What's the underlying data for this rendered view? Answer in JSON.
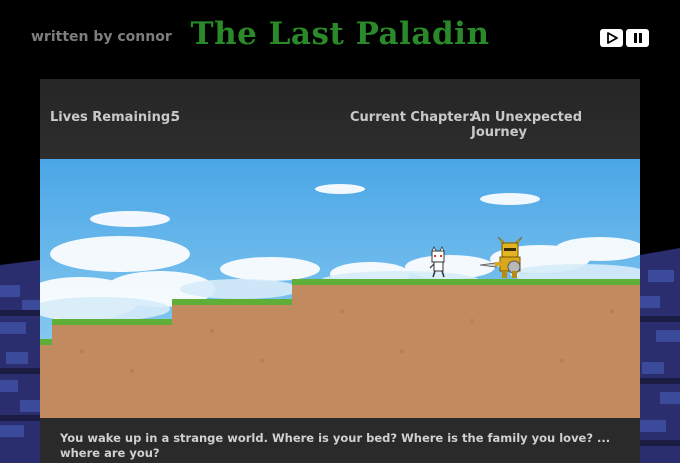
{
  "header": {
    "author": "written by connor",
    "title": "The Last Paladin",
    "play_icon": "play-icon",
    "pause_icon": "pause-icon"
  },
  "hud": {
    "lives_label": "Lives Remaining:",
    "lives_value": "5",
    "chapter_label": "Current Chapter:",
    "chapter_value": "An Unexpected Journey"
  },
  "dialog": {
    "text": "You wake up in a strange world. Where is your bed? Where is the family you love? ... where are you?"
  },
  "colors": {
    "title_green": "#2a8a2a",
    "sky": "#4aa6e6",
    "grass": "#5fae37",
    "dirt": "#c18b5f"
  }
}
